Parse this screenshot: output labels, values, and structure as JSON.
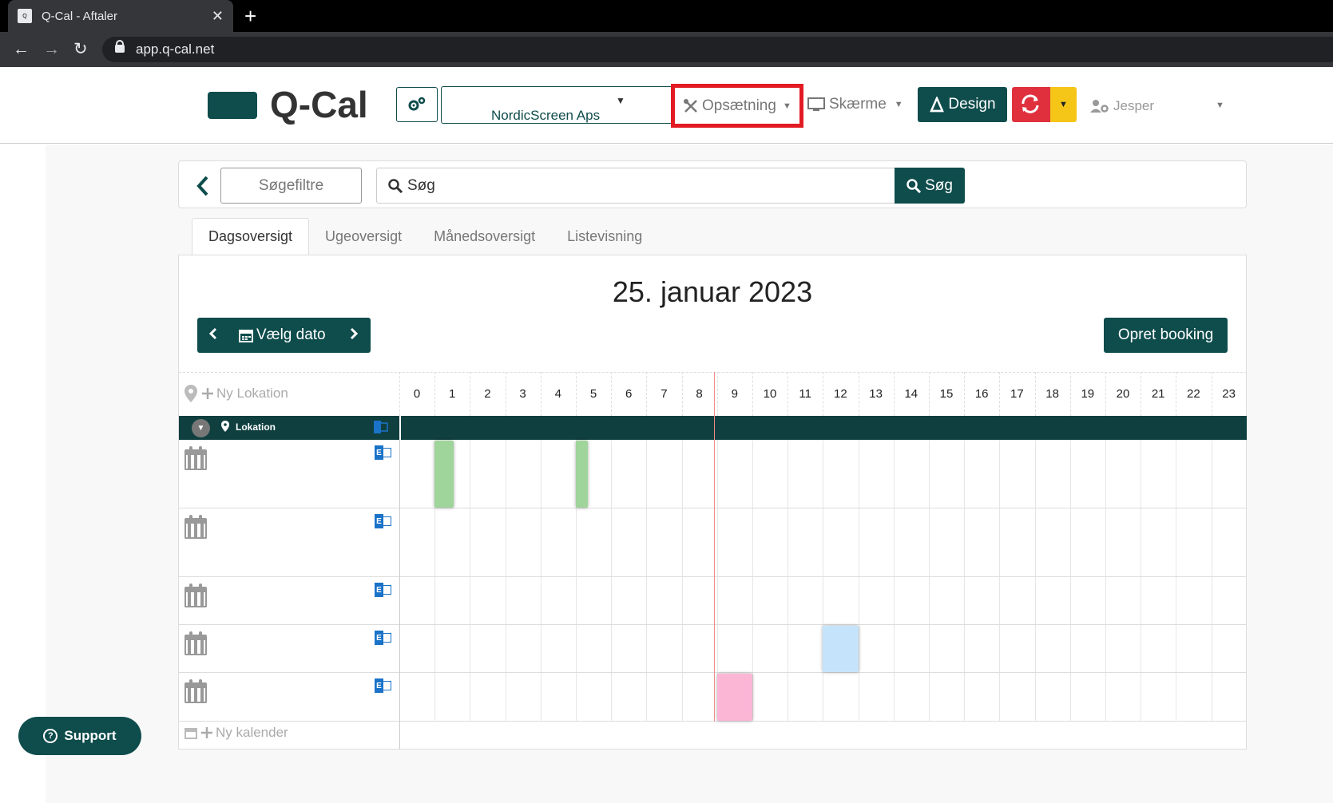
{
  "browser": {
    "tab_title": "Q-Cal - Aftaler",
    "tab_close": "✕",
    "new_tab": "+",
    "url": "app.q-cal.net",
    "back": "←",
    "forward": "→",
    "reload": "↻"
  },
  "header": {
    "logo_text": "Q-Cal",
    "company": "NordicScreen Aps",
    "setup": "Opsætning",
    "screens": "Skærme",
    "design": "Design",
    "user": "Jesper",
    "caret": "▼",
    "accent_color": "#0f4c4c",
    "highlight_color": "#e21b23"
  },
  "filters": {
    "search_filters": "Søgefiltre",
    "search_placeholder": "Søg",
    "search_button": "Søg"
  },
  "tabs": [
    {
      "label": "Dagsoversigt",
      "active": true
    },
    {
      "label": "Ugeoversigt",
      "active": false
    },
    {
      "label": "Månedsoversigt",
      "active": false
    },
    {
      "label": "Listevisning",
      "active": false
    }
  ],
  "calendar": {
    "date_title": "25. januar 2023",
    "choose_date": "Vælg dato",
    "create_booking": "Opret booking",
    "new_location": "Ny Lokation",
    "location_label": "Lokation",
    "new_calendar": "Ny kalender",
    "hours": [
      "0",
      "1",
      "2",
      "3",
      "4",
      "5",
      "6",
      "7",
      "8",
      "9",
      "10",
      "11",
      "12",
      "13",
      "14",
      "15",
      "16",
      "17",
      "18",
      "19",
      "20",
      "21",
      "22",
      "23"
    ],
    "rows": [
      {
        "bookings": [
          {
            "start": 1,
            "end": 1.55,
            "color": "#9fd49b"
          },
          {
            "start": 5,
            "end": 5.35,
            "color": "#9fd49b"
          }
        ]
      },
      {
        "bookings": []
      },
      {
        "bookings": []
      },
      {
        "bookings": [
          {
            "start": 12,
            "end": 13,
            "color": "#c5e4fb"
          }
        ]
      },
      {
        "bookings": [
          {
            "start": 9,
            "end": 10,
            "color": "#fbb6d6"
          }
        ]
      }
    ]
  },
  "support": {
    "label": "Support"
  },
  "icons": {
    "gear": "gears-icon",
    "setup": "tools-icon",
    "screens": "monitor-icon",
    "design": "design-icon",
    "sync": "sync-icon",
    "user": "user-cog-icon",
    "exchange": "exchange-icon",
    "calendar": "calendar-icon",
    "pin": "map-pin-icon"
  }
}
